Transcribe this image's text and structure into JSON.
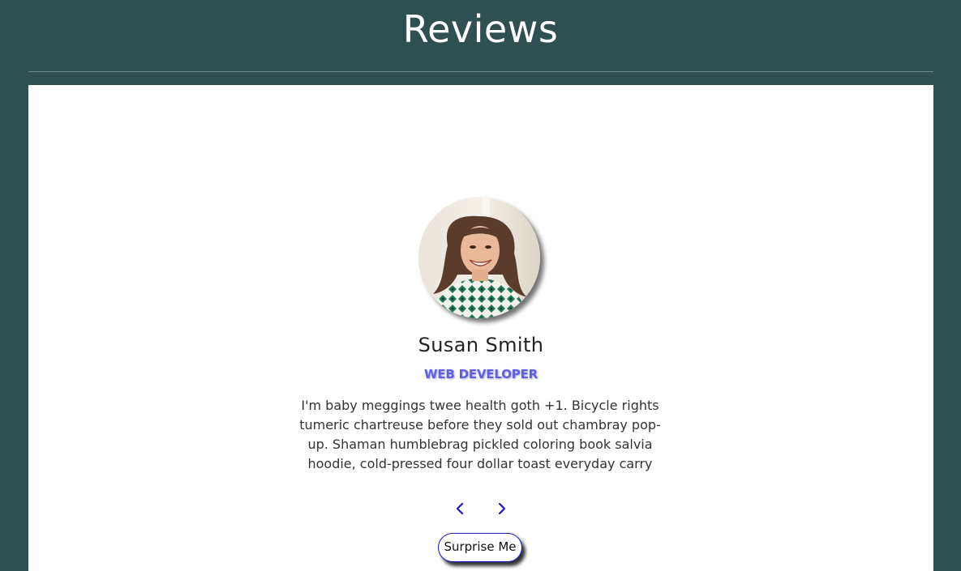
{
  "header": {
    "title": "Reviews"
  },
  "review": {
    "name": "Susan Smith",
    "job": "WEB DEVELOPER",
    "text": "I'm baby meggings twee health goth +1. Bicycle rights tumeric chartreuse before they sold out chambray pop-up. Shaman humblebrag pickled coloring book salvia hoodie, cold-pressed four dollar toast everyday carry"
  },
  "controls": {
    "prev_icon": "chevron-left-icon",
    "next_icon": "chevron-right-icon",
    "surprise_label": "Surprise Me"
  },
  "colors": {
    "background": "#2f5050",
    "card": "#ffffff",
    "accent": "#5f5fe6",
    "chevron": "#1a1acc"
  }
}
